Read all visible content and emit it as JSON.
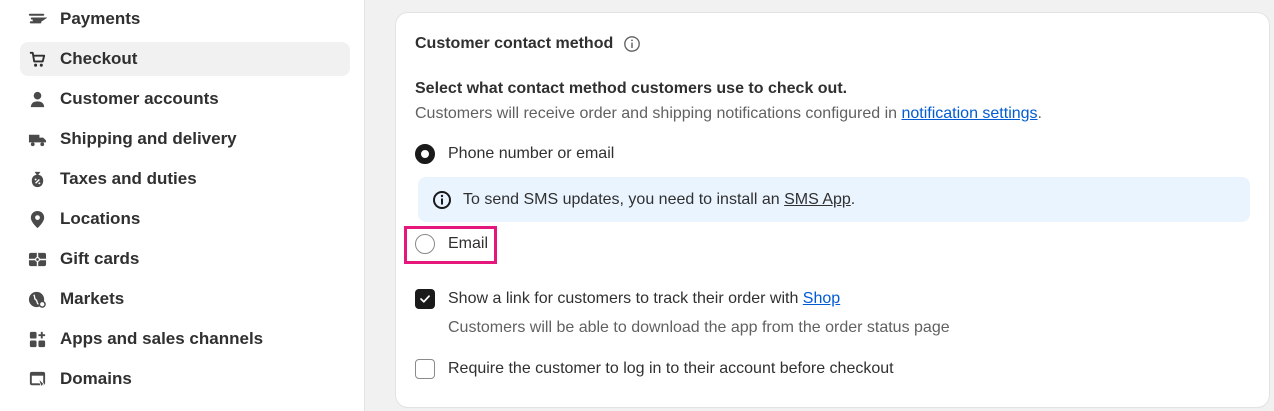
{
  "sidebar": {
    "items": [
      {
        "label": "Payments",
        "icon": "payments-icon",
        "active": false
      },
      {
        "label": "Checkout",
        "icon": "cart-icon",
        "active": true
      },
      {
        "label": "Customer accounts",
        "icon": "person-icon",
        "active": false
      },
      {
        "label": "Shipping and delivery",
        "icon": "truck-icon",
        "active": false
      },
      {
        "label": "Taxes and duties",
        "icon": "tax-bag-icon",
        "active": false
      },
      {
        "label": "Locations",
        "icon": "location-pin-icon",
        "active": false
      },
      {
        "label": "Gift cards",
        "icon": "gift-card-icon",
        "active": false
      },
      {
        "label": "Markets",
        "icon": "globe-icon",
        "active": false
      },
      {
        "label": "Apps and sales channels",
        "icon": "apps-icon",
        "active": false
      },
      {
        "label": "Domains",
        "icon": "domain-icon",
        "active": false
      }
    ]
  },
  "card": {
    "title": "Customer contact method",
    "description": "Select what contact method customers use to check out.",
    "sub_description_prefix": "Customers will receive order and shipping notifications configured in ",
    "sub_description_link": "notification settings",
    "sub_description_suffix": ".",
    "options": [
      {
        "label": "Phone number or email",
        "selected": true
      },
      {
        "label": "Email",
        "selected": false
      }
    ],
    "banner": {
      "text_prefix": "To send SMS updates, you need to install an ",
      "link": "SMS App",
      "text_suffix": "."
    },
    "track_link": {
      "label_prefix": "Show a link for customers to track their order with ",
      "link": "Shop",
      "checked": true,
      "help": "Customers will be able to download the app from the order status page"
    },
    "require_login": {
      "label": "Require the customer to log in to their account before checkout",
      "checked": false
    }
  },
  "colors": {
    "highlight": "#e6177a",
    "link": "#005bd3",
    "banner_bg": "#eaf4ff",
    "active_nav_bg": "#f1f1f1"
  }
}
